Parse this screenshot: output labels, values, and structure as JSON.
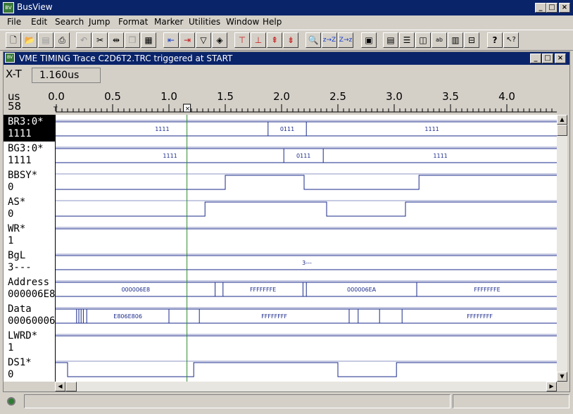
{
  "app": {
    "title": "BusView"
  },
  "menu": [
    "File",
    "Edit",
    "Search",
    "Jump",
    "Format",
    "Marker",
    "Utilities",
    "Window",
    "Help"
  ],
  "trace": {
    "title": "VME TIMING Trace C2D6T2.TRC triggered at START",
    "xt_label": "X-T",
    "xt_value": "1.160us",
    "units": "us",
    "zoom": "58",
    "ticks": [
      "0.0",
      "0.5",
      "1.0",
      "1.5",
      "2.0",
      "2.5",
      "3.0",
      "3.5",
      "4.0"
    ],
    "cursor_time": 1.16
  },
  "signals": [
    {
      "name": "BR3:0*",
      "value": "1111",
      "selected": true,
      "type": "bus",
      "segments": [
        [
          0,
          1.88,
          "1111"
        ],
        [
          1.88,
          2.22,
          "0111"
        ],
        [
          2.22,
          4.45,
          "1111"
        ]
      ]
    },
    {
      "name": "BG3:0*",
      "value": "1111",
      "type": "bus",
      "segments": [
        [
          0,
          2.02,
          "1111"
        ],
        [
          2.02,
          2.37,
          "0111"
        ],
        [
          2.37,
          4.45,
          "1111"
        ]
      ]
    },
    {
      "name": "BBSY*",
      "value": "0",
      "type": "wave",
      "edges": [
        [
          0,
          0
        ],
        [
          1.5,
          1
        ],
        [
          2.2,
          0
        ],
        [
          3.22,
          1
        ]
      ]
    },
    {
      "name": "AS*",
      "value": "0",
      "type": "wave",
      "edges": [
        [
          0,
          0
        ],
        [
          1.32,
          1
        ],
        [
          2.4,
          0
        ],
        [
          3.1,
          1
        ]
      ]
    },
    {
      "name": "WR*",
      "value": "1",
      "type": "wave",
      "edges": [
        [
          0,
          1
        ]
      ]
    },
    {
      "name": "BgL",
      "value": "3---",
      "type": "bus",
      "segments": [
        [
          0,
          4.45,
          "3---"
        ]
      ]
    },
    {
      "name": "Address",
      "value": "000006E8",
      "type": "bus",
      "segments": [
        [
          0,
          1.41,
          "000006E8"
        ],
        [
          1.41,
          1.48,
          ""
        ],
        [
          1.48,
          2.19,
          "FFFFFFFE"
        ],
        [
          2.19,
          2.22,
          ""
        ],
        [
          2.22,
          3.2,
          "000006EA"
        ],
        [
          3.2,
          4.45,
          "FFFFFFFE"
        ]
      ]
    },
    {
      "name": "Data",
      "value": "00060006",
      "type": "bus",
      "segments": [
        [
          0,
          0.18,
          ""
        ],
        [
          0.18,
          0.2,
          ""
        ],
        [
          0.2,
          0.22,
          ""
        ],
        [
          0.22,
          0.24,
          ""
        ],
        [
          0.24,
          0.27,
          ""
        ],
        [
          0.27,
          1.0,
          "E806E806"
        ],
        [
          1.0,
          1.27,
          ""
        ],
        [
          1.27,
          2.6,
          "FFFFFFFF"
        ],
        [
          2.6,
          2.68,
          ""
        ],
        [
          2.68,
          2.87,
          ""
        ],
        [
          2.87,
          3.07,
          ""
        ],
        [
          3.07,
          4.45,
          "FFFFFFFF"
        ]
      ]
    },
    {
      "name": "LWRD*",
      "value": "1",
      "type": "wave",
      "edges": [
        [
          0,
          1
        ]
      ]
    },
    {
      "name": "DS1*",
      "value": "0",
      "type": "wave",
      "edges": [
        [
          0,
          1
        ],
        [
          0.1,
          0
        ],
        [
          1.22,
          1
        ],
        [
          2.5,
          0
        ],
        [
          3.02,
          1
        ]
      ]
    }
  ],
  "colors": {
    "titlebar": "#0a246a",
    "cursor": "#2e8b2e",
    "selected": "#000000"
  }
}
